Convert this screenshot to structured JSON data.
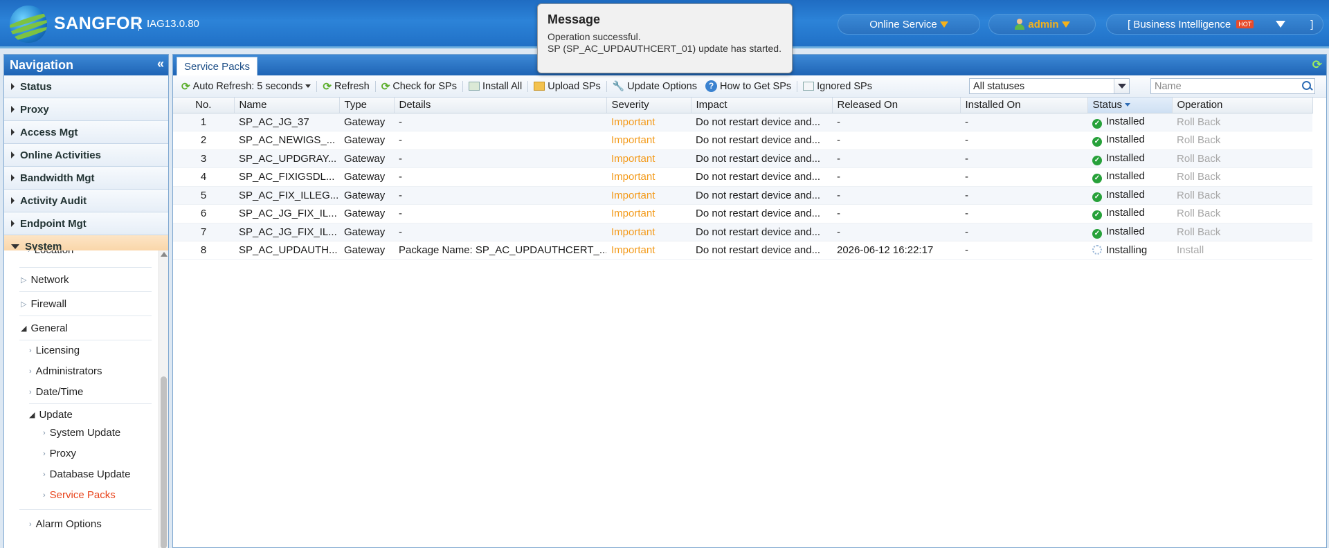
{
  "header": {
    "brand": "SANGFOR",
    "version": "IAG13.0.80",
    "online_service": "Online Service",
    "user": "admin",
    "bi": "[  Business Intelligence",
    "bi_close": "]",
    "hot": "HOT"
  },
  "message": {
    "title": "Message",
    "text": "Operation successful.\nSP (SP_AC_UPDAUTHCERT_01) update has started."
  },
  "nav": {
    "title": "Navigation",
    "sections": [
      "Status",
      "Proxy",
      "Access Mgt",
      "Online Activities",
      "Bandwidth Mgt",
      "Activity Audit",
      "Endpoint Mgt"
    ],
    "active_section": "System",
    "tree": {
      "location": "Location",
      "network": "Network",
      "firewall": "Firewall",
      "general": "General",
      "licensing": "Licensing",
      "administrators": "Administrators",
      "datetime": "Date/Time",
      "update": "Update",
      "system_update": "System Update",
      "proxy": "Proxy",
      "database_update": "Database Update",
      "service_packs": "Service Packs",
      "alarm_options": "Alarm Options"
    }
  },
  "tab": "Service Packs",
  "toolbar": {
    "auto_refresh": "Auto Refresh: 5 seconds",
    "refresh": "Refresh",
    "check": "Check for SPs",
    "install_all": "Install All",
    "upload": "Upload SPs",
    "update_options": "Update Options",
    "how_to": "How to Get SPs",
    "ignored": "Ignored SPs",
    "status_filter": "All statuses",
    "search_placeholder": "Name"
  },
  "table": {
    "columns": [
      "No.",
      "Name",
      "Type",
      "Details",
      "Severity",
      "Impact",
      "Released On",
      "Installed On",
      "Status",
      "Operation"
    ],
    "rows": [
      [
        "1",
        "SP_AC_JG_37",
        "Gateway",
        "-",
        "Important",
        "Do not restart device and...",
        "-",
        "-",
        "Installed",
        "Roll Back"
      ],
      [
        "2",
        "SP_AC_NEWIGS_...",
        "Gateway",
        "-",
        "Important",
        "Do not restart device and...",
        "-",
        "-",
        "Installed",
        "Roll Back"
      ],
      [
        "3",
        "SP_AC_UPDGRAY...",
        "Gateway",
        "-",
        "Important",
        "Do not restart device and...",
        "-",
        "-",
        "Installed",
        "Roll Back"
      ],
      [
        "4",
        "SP_AC_FIXIGSDL...",
        "Gateway",
        "-",
        "Important",
        "Do not restart device and...",
        "-",
        "-",
        "Installed",
        "Roll Back"
      ],
      [
        "5",
        "SP_AC_FIX_ILLEG...",
        "Gateway",
        "-",
        "Important",
        "Do not restart device and...",
        "-",
        "-",
        "Installed",
        "Roll Back"
      ],
      [
        "6",
        "SP_AC_JG_FIX_IL...",
        "Gateway",
        "-",
        "Important",
        "Do not restart device and...",
        "-",
        "-",
        "Installed",
        "Roll Back"
      ],
      [
        "7",
        "SP_AC_JG_FIX_IL...",
        "Gateway",
        "-",
        "Important",
        "Do not restart device and...",
        "-",
        "-",
        "Installed",
        "Roll Back"
      ],
      [
        "8",
        "SP_AC_UPDAUTH...",
        "Gateway",
        "Package Name: SP_AC_UPDAUTHCERT_...",
        "Important",
        "Do not restart device and...",
        "2026-06-12 16:22:17",
        "-",
        "Installing",
        "Install"
      ]
    ]
  }
}
